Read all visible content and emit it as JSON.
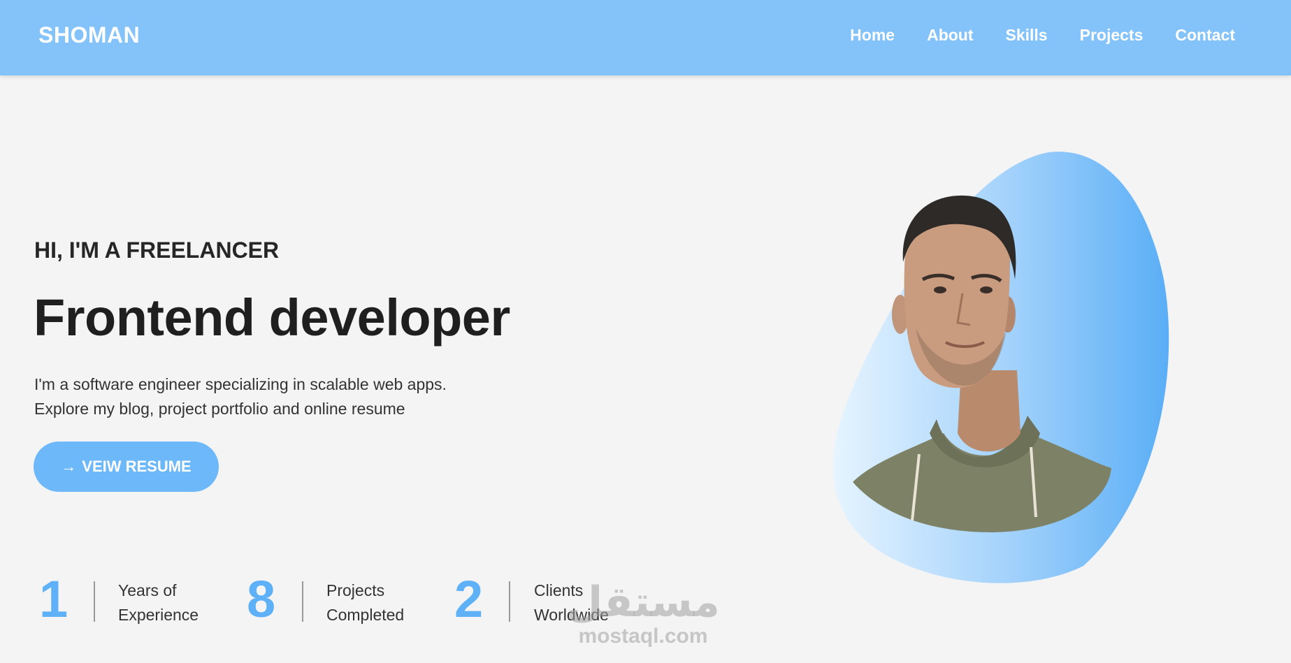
{
  "header": {
    "brand": "SHOMAN",
    "nav": [
      "Home",
      "About",
      "Skills",
      "Projects",
      "Contact"
    ]
  },
  "hero": {
    "eyebrow": "HI, I'M A FREELANCER",
    "headline": "Frontend developer",
    "description": [
      "I'm a software engineer specializing in scalable web apps.",
      "Explore my blog, project portfolio and online resume"
    ],
    "cta_label": "VEIW RESUME",
    "cta_icon": "arrow-right-icon"
  },
  "stats": [
    {
      "number": "1",
      "label_line1": "Years of",
      "label_line2": "Experience"
    },
    {
      "number": "8",
      "label_line1": "Projects",
      "label_line2": "Completed"
    },
    {
      "number": "2",
      "label_line1": "Clients",
      "label_line2": "Worldwide"
    }
  ],
  "watermark": {
    "arabic": "مستقل",
    "latin": "mostaql.com"
  },
  "colors": {
    "header_bg": "#84c3fa",
    "accent": "#5eb0f7",
    "button_bg": "#6db8f9",
    "page_bg": "#f4f4f4",
    "text_dark": "#1f1f1f"
  }
}
